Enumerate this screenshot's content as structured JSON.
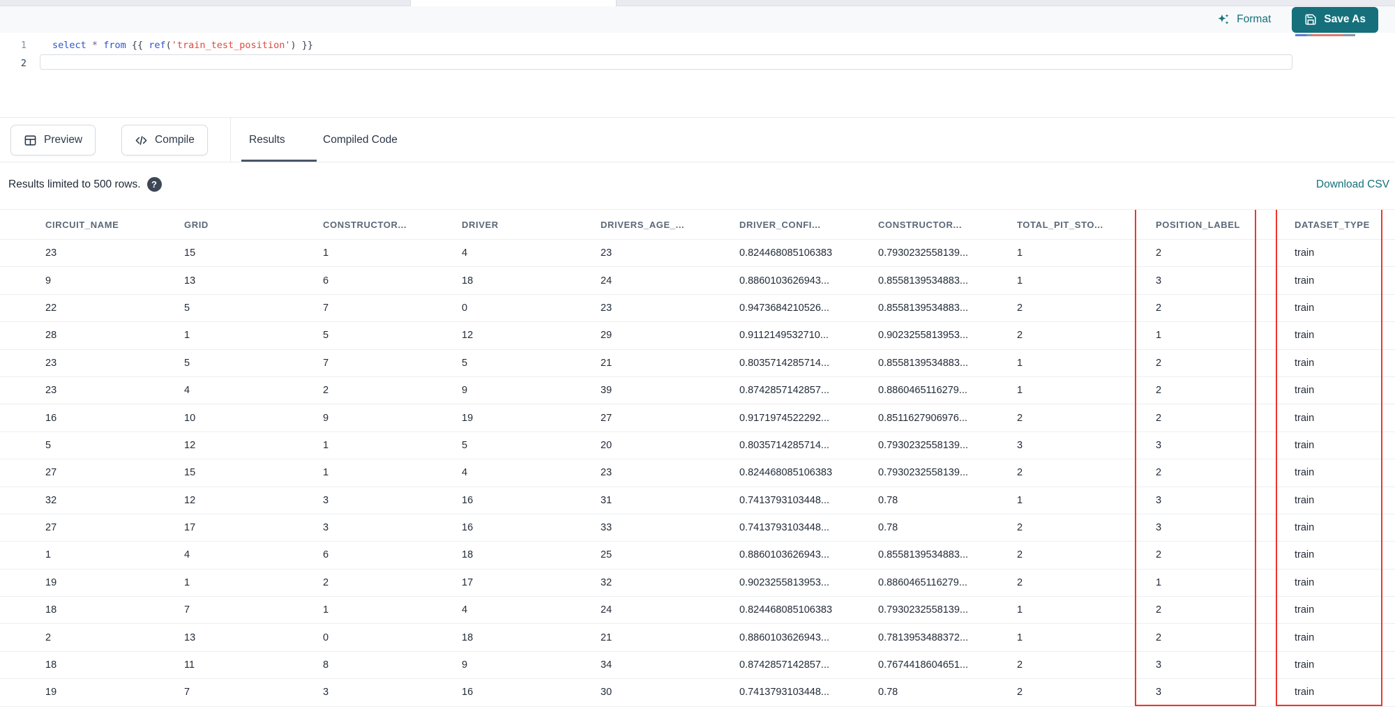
{
  "toolbar": {
    "format_label": "Format",
    "save_as_label": "Save As"
  },
  "editor": {
    "line_numbers": [
      "1",
      "2"
    ],
    "code_tokens": [
      {
        "t": "select",
        "c": "keyword"
      },
      {
        "t": " ",
        "c": "plain"
      },
      {
        "t": "*",
        "c": "operator"
      },
      {
        "t": " ",
        "c": "plain"
      },
      {
        "t": "from",
        "c": "keyword"
      },
      {
        "t": " {{ ",
        "c": "plain"
      },
      {
        "t": "ref",
        "c": "function"
      },
      {
        "t": "(",
        "c": "plain"
      },
      {
        "t": "'train_test_position'",
        "c": "string"
      },
      {
        "t": ")",
        "c": "plain"
      },
      {
        "t": " }}",
        "c": "plain"
      }
    ]
  },
  "action_bar": {
    "preview_label": "Preview",
    "compile_label": "Compile",
    "tabs": [
      {
        "label": "Results",
        "active": true
      },
      {
        "label": "Compiled Code",
        "active": false
      }
    ]
  },
  "results": {
    "limit_note": "Results limited to 500 rows.",
    "download_csv_label": "Download CSV",
    "table": {
      "headers": [
        "CIRCUIT_NAME",
        "GRID",
        "CONSTRUCTOR...",
        "DRIVER",
        "DRIVERS_AGE_...",
        "DRIVER_CONFI...",
        "CONSTRUCTOR...",
        "TOTAL_PIT_STO...",
        "POSITION_LABEL",
        "DATASET_TYPE"
      ],
      "rows": [
        [
          "23",
          "15",
          "1",
          "4",
          "23",
          "0.824468085106383",
          "0.7930232558139...",
          "1",
          "2",
          "train"
        ],
        [
          "9",
          "13",
          "6",
          "18",
          "24",
          "0.8860103626943...",
          "0.8558139534883...",
          "1",
          "3",
          "train"
        ],
        [
          "22",
          "5",
          "7",
          "0",
          "23",
          "0.9473684210526...",
          "0.8558139534883...",
          "2",
          "2",
          "train"
        ],
        [
          "28",
          "1",
          "5",
          "12",
          "29",
          "0.9112149532710...",
          "0.9023255813953...",
          "2",
          "1",
          "train"
        ],
        [
          "23",
          "5",
          "7",
          "5",
          "21",
          "0.8035714285714...",
          "0.8558139534883...",
          "1",
          "2",
          "train"
        ],
        [
          "23",
          "4",
          "2",
          "9",
          "39",
          "0.8742857142857...",
          "0.8860465116279...",
          "1",
          "2",
          "train"
        ],
        [
          "16",
          "10",
          "9",
          "19",
          "27",
          "0.9171974522292...",
          "0.8511627906976...",
          "2",
          "2",
          "train"
        ],
        [
          "5",
          "12",
          "1",
          "5",
          "20",
          "0.8035714285714...",
          "0.7930232558139...",
          "3",
          "3",
          "train"
        ],
        [
          "27",
          "15",
          "1",
          "4",
          "23",
          "0.824468085106383",
          "0.7930232558139...",
          "2",
          "2",
          "train"
        ],
        [
          "32",
          "12",
          "3",
          "16",
          "31",
          "0.7413793103448...",
          "0.78",
          "1",
          "3",
          "train"
        ],
        [
          "27",
          "17",
          "3",
          "16",
          "33",
          "0.7413793103448...",
          "0.78",
          "2",
          "3",
          "train"
        ],
        [
          "1",
          "4",
          "6",
          "18",
          "25",
          "0.8860103626943...",
          "0.8558139534883...",
          "2",
          "2",
          "train"
        ],
        [
          "19",
          "1",
          "2",
          "17",
          "32",
          "0.9023255813953...",
          "0.8860465116279...",
          "2",
          "1",
          "train"
        ],
        [
          "18",
          "7",
          "1",
          "4",
          "24",
          "0.824468085106383",
          "0.7930232558139...",
          "1",
          "2",
          "train"
        ],
        [
          "2",
          "13",
          "0",
          "18",
          "21",
          "0.8860103626943...",
          "0.7813953488372...",
          "1",
          "2",
          "train"
        ],
        [
          "18",
          "11",
          "8",
          "9",
          "34",
          "0.8742857142857...",
          "0.7674418604651...",
          "2",
          "3",
          "train"
        ],
        [
          "19",
          "7",
          "3",
          "16",
          "30",
          "0.7413793103448...",
          "0.78",
          "2",
          "3",
          "train"
        ]
      ],
      "highlighted_columns": [
        "POSITION_LABEL",
        "DATASET_TYPE"
      ]
    }
  },
  "colors": {
    "accent_teal": "#15707b",
    "highlight_red": "#ee352c"
  }
}
